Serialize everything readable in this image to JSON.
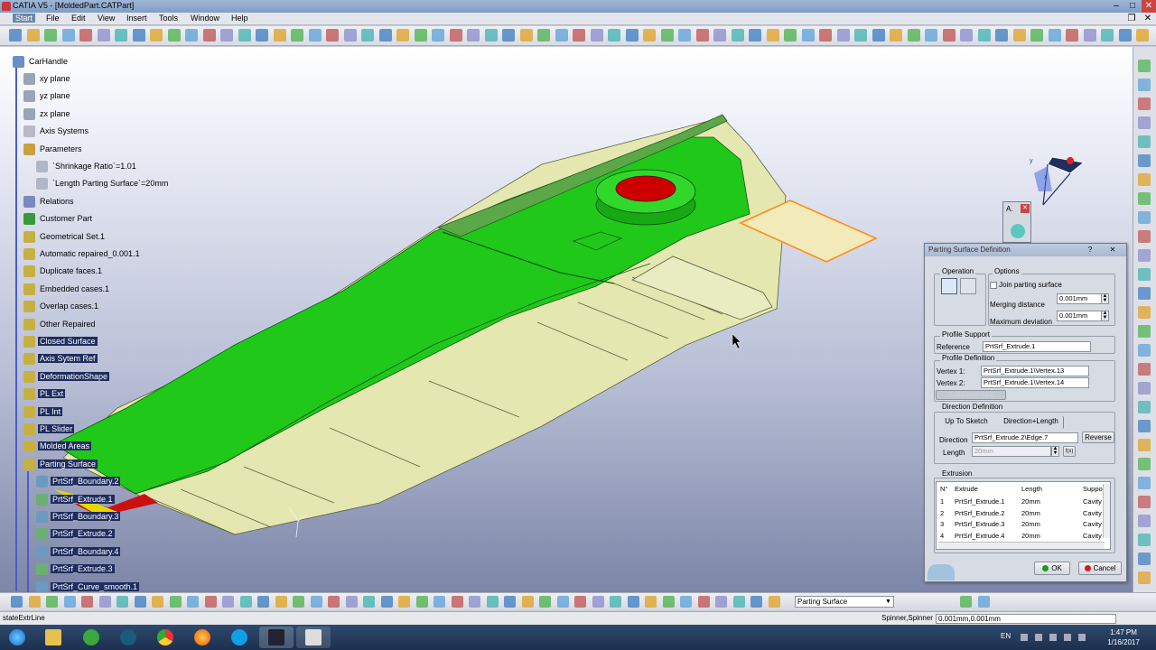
{
  "window": {
    "title": "CATIA V5 - [MoldedPart.CATPart]"
  },
  "menu": [
    "Start",
    "File",
    "Edit",
    "View",
    "Insert",
    "Tools",
    "Window",
    "Help"
  ],
  "tree": {
    "root": "CarHandle",
    "nodes": [
      {
        "label": "xy plane"
      },
      {
        "label": "yz plane"
      },
      {
        "label": "zx plane"
      },
      {
        "label": "Axis Systems"
      },
      {
        "label": "Parameters"
      },
      {
        "label": "`Shrinkage Ratio`=1.01"
      },
      {
        "label": "`Length Parting Surface`=20mm"
      },
      {
        "label": "Relations"
      },
      {
        "label": "Customer Part"
      },
      {
        "label": "Geometrical Set.1"
      },
      {
        "label": "Automatic repaired_0.001.1"
      },
      {
        "label": "Duplicate faces.1"
      },
      {
        "label": "Embedded cases.1"
      },
      {
        "label": "Overlap cases.1"
      },
      {
        "label": "Other Repaired"
      },
      {
        "label": "Closed Surface"
      },
      {
        "label": "Axis Sytem Ref"
      },
      {
        "label": "DeformationShape"
      },
      {
        "label": "PL Ext"
      },
      {
        "label": "PL Int"
      },
      {
        "label": "PL Slider"
      },
      {
        "label": "Molded Areas"
      },
      {
        "label": "Parting Surface"
      },
      {
        "label": "PrtSrf_Boundary.2"
      },
      {
        "label": "PrtSrf_Extrude.1"
      },
      {
        "label": "PrtSrf_Boundary.3"
      },
      {
        "label": "PrtSrf_Extrude.2"
      },
      {
        "label": "PrtSrf_Boundary.4"
      },
      {
        "label": "PrtSrf_Extrude.3"
      },
      {
        "label": "PrtSrf_Curve_smooth.1"
      }
    ]
  },
  "compass": {
    "y_label": "y",
    "x_label": "x"
  },
  "minipanel": {
    "label": "A."
  },
  "dialog": {
    "title": "Parting Surface Definition",
    "help": "?",
    "close": "✕",
    "operation_label": "Operation",
    "options_label": "Options",
    "join_label": "Join parting surface",
    "merging_label": "Merging distance",
    "merging_value": "0.001mm",
    "maxdev_label": "Maximum deviation",
    "maxdev_value": "0.001mm",
    "profile_support_label": "Profile Support",
    "reference_label": "Reference",
    "reference_value": "PrtSrf_Extrude.1",
    "profile_def_label": "Profile Definition",
    "vertex1_label": "Vertex 1:",
    "vertex1_value": "PrtSrf_Extrude.1\\Vertex.13",
    "vertex2_label": "Vertex 2:",
    "vertex2_value": "PrtSrf_Extrude.1\\Vertex.14",
    "complementary_label": "Complementary",
    "direction_def_label": "Direction Definition",
    "uptosketch_label": "Up To Sketch",
    "dirlength_label": "Direction+Length",
    "direction_label": "Direction",
    "direction_value": "PrtSrf_Extrude.2\\Edge.7",
    "reverse_label": "Reverse",
    "length_label": "Length",
    "length_value": "20mm",
    "formula_label": "f(x)",
    "extrusion_label": "Extrusion",
    "columns": [
      "N°",
      "Extrude",
      "Length",
      "Suppo"
    ],
    "rows": [
      [
        "1",
        "PrtSrf_Extrude.1",
        "20mm",
        "Cavity"
      ],
      [
        "2",
        "PrtSrf_Extrude.2",
        "20mm",
        "Cavity"
      ],
      [
        "3",
        "PrtSrf_Extrude.3",
        "20mm",
        "Cavity"
      ],
      [
        "4",
        "PrtSrf_Extrude.4",
        "20mm",
        "Cavity"
      ]
    ],
    "ok_label": "OK",
    "cancel_label": "Cancel"
  },
  "bottom_toolbar": {
    "workbench_combo": "Parting Surface"
  },
  "status": {
    "left": "stateExtrLine",
    "field_label": "Spinner,Spinner",
    "field_value": "0.001mm,0.001mm"
  },
  "taskbar": {
    "lang": "EN",
    "time": "1:47 PM",
    "date": "1/16/2017"
  },
  "colors": {
    "part_green": "#20c81a",
    "part_yellow": "#e4e8b0",
    "selected_orange": "#ff8c1a",
    "tree_selection": "#1f2d5f"
  }
}
